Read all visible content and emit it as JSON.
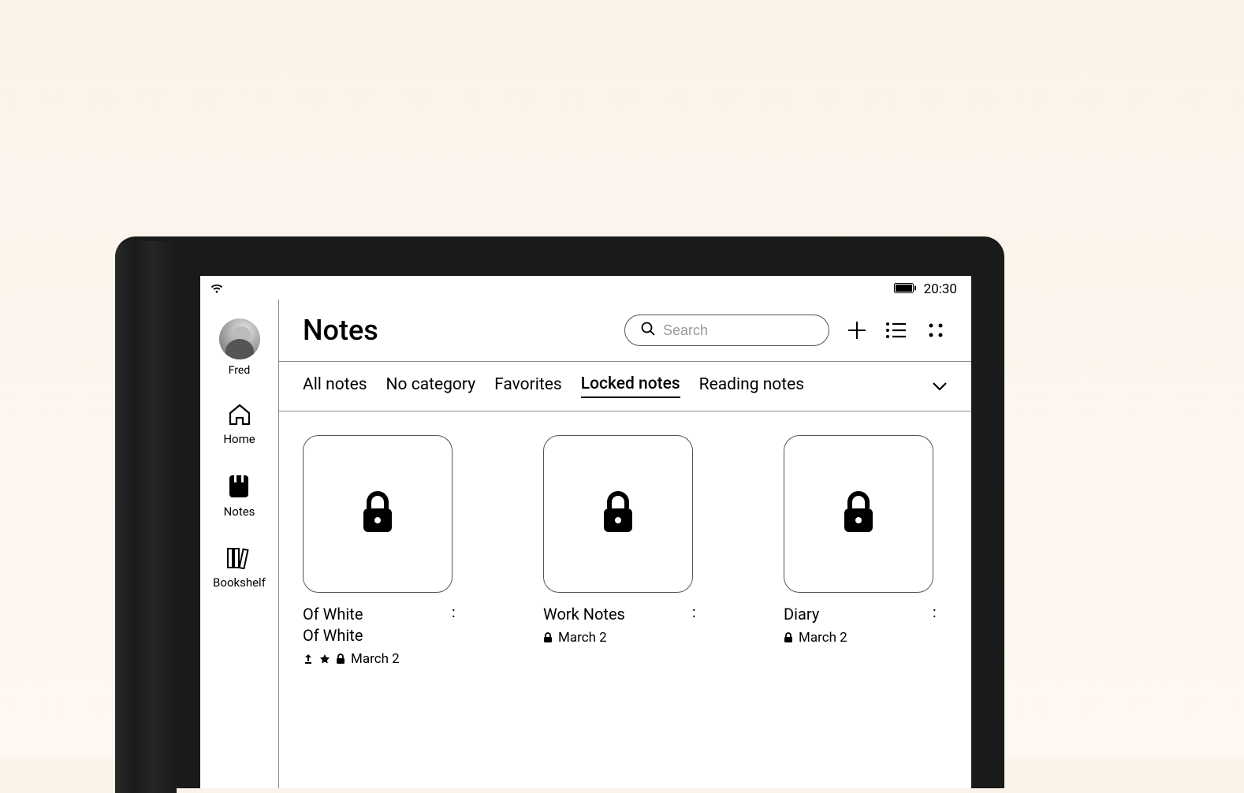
{
  "status": {
    "time": "20:30"
  },
  "user": {
    "name": "Fred"
  },
  "nav": {
    "home": "Home",
    "notes": "Notes",
    "bookshelf": "Bookshelf"
  },
  "header": {
    "title": "Notes",
    "search_placeholder": "Search"
  },
  "tabs": {
    "all": "All notes",
    "none": "No category",
    "favorites": "Favorites",
    "locked": "Locked notes",
    "reading": "Reading notes"
  },
  "notes": [
    {
      "title1": "Of White",
      "title2": "Of White",
      "date": "March 2",
      "sync": true,
      "star": true,
      "lock": true
    },
    {
      "title1": "Work Notes",
      "title2": "",
      "date": "March 2",
      "sync": false,
      "star": false,
      "lock": true
    },
    {
      "title1": "Diary",
      "title2": "",
      "date": "March 2",
      "sync": false,
      "star": false,
      "lock": true
    }
  ]
}
